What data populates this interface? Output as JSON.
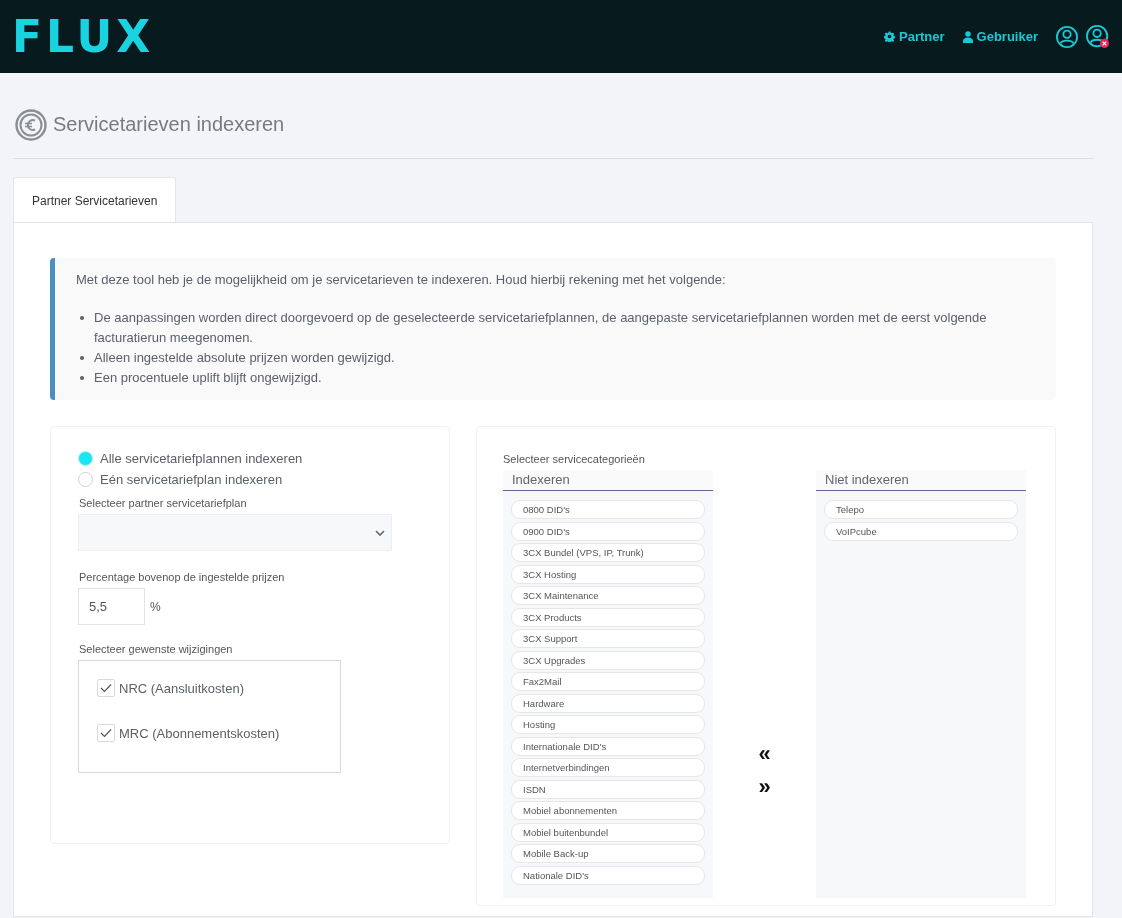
{
  "header": {
    "logo": "FLUX",
    "nav": [
      {
        "kind": "gear",
        "label": "Partner"
      },
      {
        "kind": "user",
        "label": "Gebruiker"
      }
    ]
  },
  "page_title": "Servicetarieven indexeren",
  "tabs": [
    {
      "label": "Partner Servicetarieven",
      "selected": true
    }
  ],
  "info": {
    "intro": "Met deze tool heb je de mogelijkheid om je servicetarieven te indexeren. Houd hierbij rekening met het volgende:",
    "bullets": [
      "De aanpassingen worden direct doorgevoerd op de geselecteerde servicetariefplannen, de aangepaste servicetariefplannen worden met de eerst volgende facturatierun meegenomen.",
      "Alleen ingestelde absolute prijzen worden gewijzigd.",
      "Een procentuele uplift blijft ongewijzigd."
    ]
  },
  "form": {
    "radios": [
      {
        "label": "Alle servicetariefplannen indexeren",
        "selected": true
      },
      {
        "label": "Eén servicetariefplan indexeren",
        "selected": false
      }
    ],
    "plan_select": {
      "label": "Selecteer partner servicetariefplan"
    },
    "percentage": {
      "label": "Percentage bovenop de ingestelde prijzen",
      "value": "5,5",
      "unit": "%"
    },
    "changes": {
      "label": "Selecteer gewenste wijzigingen",
      "options": [
        {
          "label": "NRC (Aansluitkosten)",
          "checked": true
        },
        {
          "label": "MRC (Abonnementskosten)",
          "checked": true
        }
      ]
    }
  },
  "categories": {
    "label": "Selecteer servicecategorieën",
    "lists": [
      {
        "title": "Indexeren",
        "items": [
          "0800 DID's",
          "0900 DID's",
          "3CX Bundel (VPS, IP, Trunk)",
          "3CX Hosting",
          "3CX Maintenance",
          "3CX Products",
          "3CX Support",
          "3CX Upgrades",
          "Fax2Mail",
          "Hardware",
          "Hosting",
          "Internationale DID's",
          "Internetverbindingen",
          "ISDN",
          "Mobiel abonnementen",
          "Mobiel buitenbundel",
          "Mobile Back-up",
          "Nationale DID's"
        ]
      },
      {
        "title": "Niet indexeren",
        "items": [
          "Telepo",
          "VoIPcube"
        ]
      }
    ],
    "move_buttons": [
      "«",
      "»"
    ]
  }
}
